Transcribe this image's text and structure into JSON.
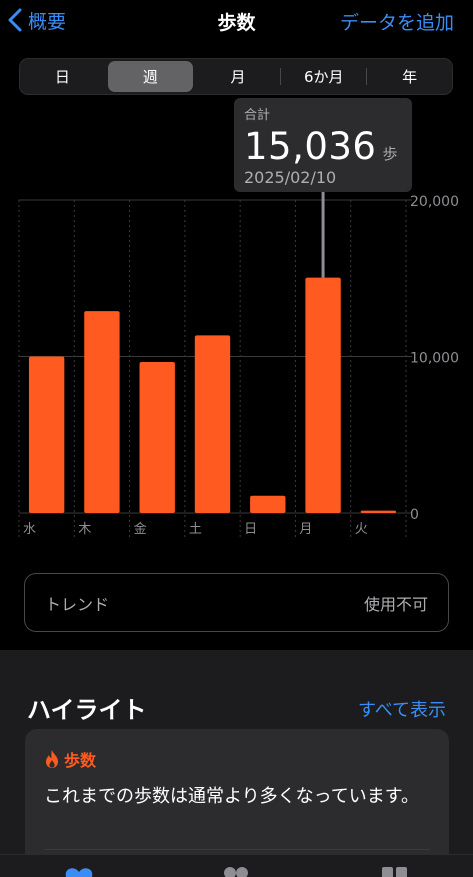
{
  "nav": {
    "back_label": "概要",
    "title": "歩数",
    "action_label": "データを追加"
  },
  "segments": [
    {
      "label": "日",
      "active": false
    },
    {
      "label": "週",
      "active": true
    },
    {
      "label": "月",
      "active": false
    },
    {
      "label": "6か月",
      "active": false
    },
    {
      "label": "年",
      "active": false
    }
  ],
  "tooltip": {
    "label": "合計",
    "value": "15,036",
    "unit": "歩",
    "date": "2025/02/10"
  },
  "chart_data": {
    "type": "bar",
    "categories": [
      "水",
      "木",
      "金",
      "土",
      "日",
      "月",
      "火"
    ],
    "values": [
      10000,
      12900,
      9650,
      11350,
      1100,
      15036,
      150
    ],
    "ylim": [
      0,
      20000
    ],
    "yticks": [
      "20,000",
      "10,000",
      "0"
    ],
    "ytick_values": [
      20000,
      10000,
      0
    ],
    "grid": true,
    "highlighted_index": 5,
    "bar_color": "#ff5a1f"
  },
  "trend": {
    "label": "トレンド",
    "value": "使用不可"
  },
  "highlights": {
    "title": "ハイライト",
    "show_all": "すべて表示",
    "card": {
      "icon": "flame-icon",
      "name": "歩数",
      "text": "これまでの歩数は通常より多くなっています。"
    }
  },
  "colors": {
    "accent_blue": "#3a8df5",
    "accent_orange": "#ff5a1f",
    "background": "#000000"
  }
}
